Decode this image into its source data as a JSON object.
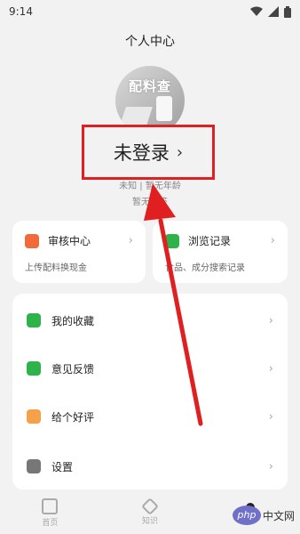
{
  "status": {
    "time": "9:14"
  },
  "page_title": "个人中心",
  "avatar_text": "配料查",
  "login": {
    "label": "未登录",
    "chevron": "›"
  },
  "profile": {
    "line1": "未知 | 暂无年龄",
    "line2": "暂无标签"
  },
  "cards": [
    {
      "title": "审核中心",
      "sub": "上传配料换现金",
      "icon_color": "#f06a3a",
      "icon": "review-icon"
    },
    {
      "title": "浏览记录",
      "sub": "食品、成分搜索记录",
      "icon_color": "#2db34a",
      "icon": "history-icon"
    }
  ],
  "menu": [
    {
      "label": "我的收藏",
      "icon_color": "#2db34a",
      "icon": "star-icon"
    },
    {
      "label": "意见反馈",
      "icon_color": "#2db34a",
      "icon": "feedback-icon"
    },
    {
      "label": "给个好评",
      "icon_color": "#f5a14a",
      "icon": "thumbs-up-icon"
    },
    {
      "label": "设置",
      "icon_color": "#777777",
      "icon": "gear-icon"
    }
  ],
  "nav": [
    {
      "label": "首页",
      "icon": "home-icon"
    },
    {
      "label": "知识",
      "icon": "knowledge-icon"
    },
    {
      "label": "",
      "icon": "profile-icon"
    }
  ],
  "watermark": {
    "logo": "php",
    "text": "中文网"
  },
  "chevron": "›",
  "accent_annotation": "#e02020"
}
